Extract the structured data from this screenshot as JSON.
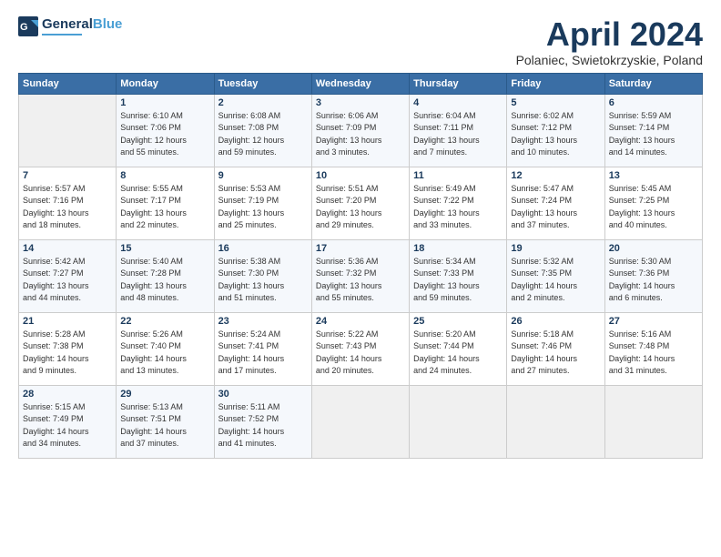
{
  "header": {
    "logo_line1": "General",
    "logo_line2": "Blue",
    "title": "April 2024",
    "location": "Polaniec, Swietokrzyskie, Poland"
  },
  "days_of_week": [
    "Sunday",
    "Monday",
    "Tuesday",
    "Wednesday",
    "Thursday",
    "Friday",
    "Saturday"
  ],
  "weeks": [
    [
      {
        "day": "",
        "info": ""
      },
      {
        "day": "1",
        "info": "Sunrise: 6:10 AM\nSunset: 7:06 PM\nDaylight: 12 hours\nand 55 minutes."
      },
      {
        "day": "2",
        "info": "Sunrise: 6:08 AM\nSunset: 7:08 PM\nDaylight: 12 hours\nand 59 minutes."
      },
      {
        "day": "3",
        "info": "Sunrise: 6:06 AM\nSunset: 7:09 PM\nDaylight: 13 hours\nand 3 minutes."
      },
      {
        "day": "4",
        "info": "Sunrise: 6:04 AM\nSunset: 7:11 PM\nDaylight: 13 hours\nand 7 minutes."
      },
      {
        "day": "5",
        "info": "Sunrise: 6:02 AM\nSunset: 7:12 PM\nDaylight: 13 hours\nand 10 minutes."
      },
      {
        "day": "6",
        "info": "Sunrise: 5:59 AM\nSunset: 7:14 PM\nDaylight: 13 hours\nand 14 minutes."
      }
    ],
    [
      {
        "day": "7",
        "info": "Sunrise: 5:57 AM\nSunset: 7:16 PM\nDaylight: 13 hours\nand 18 minutes."
      },
      {
        "day": "8",
        "info": "Sunrise: 5:55 AM\nSunset: 7:17 PM\nDaylight: 13 hours\nand 22 minutes."
      },
      {
        "day": "9",
        "info": "Sunrise: 5:53 AM\nSunset: 7:19 PM\nDaylight: 13 hours\nand 25 minutes."
      },
      {
        "day": "10",
        "info": "Sunrise: 5:51 AM\nSunset: 7:20 PM\nDaylight: 13 hours\nand 29 minutes."
      },
      {
        "day": "11",
        "info": "Sunrise: 5:49 AM\nSunset: 7:22 PM\nDaylight: 13 hours\nand 33 minutes."
      },
      {
        "day": "12",
        "info": "Sunrise: 5:47 AM\nSunset: 7:24 PM\nDaylight: 13 hours\nand 37 minutes."
      },
      {
        "day": "13",
        "info": "Sunrise: 5:45 AM\nSunset: 7:25 PM\nDaylight: 13 hours\nand 40 minutes."
      }
    ],
    [
      {
        "day": "14",
        "info": "Sunrise: 5:42 AM\nSunset: 7:27 PM\nDaylight: 13 hours\nand 44 minutes."
      },
      {
        "day": "15",
        "info": "Sunrise: 5:40 AM\nSunset: 7:28 PM\nDaylight: 13 hours\nand 48 minutes."
      },
      {
        "day": "16",
        "info": "Sunrise: 5:38 AM\nSunset: 7:30 PM\nDaylight: 13 hours\nand 51 minutes."
      },
      {
        "day": "17",
        "info": "Sunrise: 5:36 AM\nSunset: 7:32 PM\nDaylight: 13 hours\nand 55 minutes."
      },
      {
        "day": "18",
        "info": "Sunrise: 5:34 AM\nSunset: 7:33 PM\nDaylight: 13 hours\nand 59 minutes."
      },
      {
        "day": "19",
        "info": "Sunrise: 5:32 AM\nSunset: 7:35 PM\nDaylight: 14 hours\nand 2 minutes."
      },
      {
        "day": "20",
        "info": "Sunrise: 5:30 AM\nSunset: 7:36 PM\nDaylight: 14 hours\nand 6 minutes."
      }
    ],
    [
      {
        "day": "21",
        "info": "Sunrise: 5:28 AM\nSunset: 7:38 PM\nDaylight: 14 hours\nand 9 minutes."
      },
      {
        "day": "22",
        "info": "Sunrise: 5:26 AM\nSunset: 7:40 PM\nDaylight: 14 hours\nand 13 minutes."
      },
      {
        "day": "23",
        "info": "Sunrise: 5:24 AM\nSunset: 7:41 PM\nDaylight: 14 hours\nand 17 minutes."
      },
      {
        "day": "24",
        "info": "Sunrise: 5:22 AM\nSunset: 7:43 PM\nDaylight: 14 hours\nand 20 minutes."
      },
      {
        "day": "25",
        "info": "Sunrise: 5:20 AM\nSunset: 7:44 PM\nDaylight: 14 hours\nand 24 minutes."
      },
      {
        "day": "26",
        "info": "Sunrise: 5:18 AM\nSunset: 7:46 PM\nDaylight: 14 hours\nand 27 minutes."
      },
      {
        "day": "27",
        "info": "Sunrise: 5:16 AM\nSunset: 7:48 PM\nDaylight: 14 hours\nand 31 minutes."
      }
    ],
    [
      {
        "day": "28",
        "info": "Sunrise: 5:15 AM\nSunset: 7:49 PM\nDaylight: 14 hours\nand 34 minutes."
      },
      {
        "day": "29",
        "info": "Sunrise: 5:13 AM\nSunset: 7:51 PM\nDaylight: 14 hours\nand 37 minutes."
      },
      {
        "day": "30",
        "info": "Sunrise: 5:11 AM\nSunset: 7:52 PM\nDaylight: 14 hours\nand 41 minutes."
      },
      {
        "day": "",
        "info": ""
      },
      {
        "day": "",
        "info": ""
      },
      {
        "day": "",
        "info": ""
      },
      {
        "day": "",
        "info": ""
      }
    ]
  ]
}
